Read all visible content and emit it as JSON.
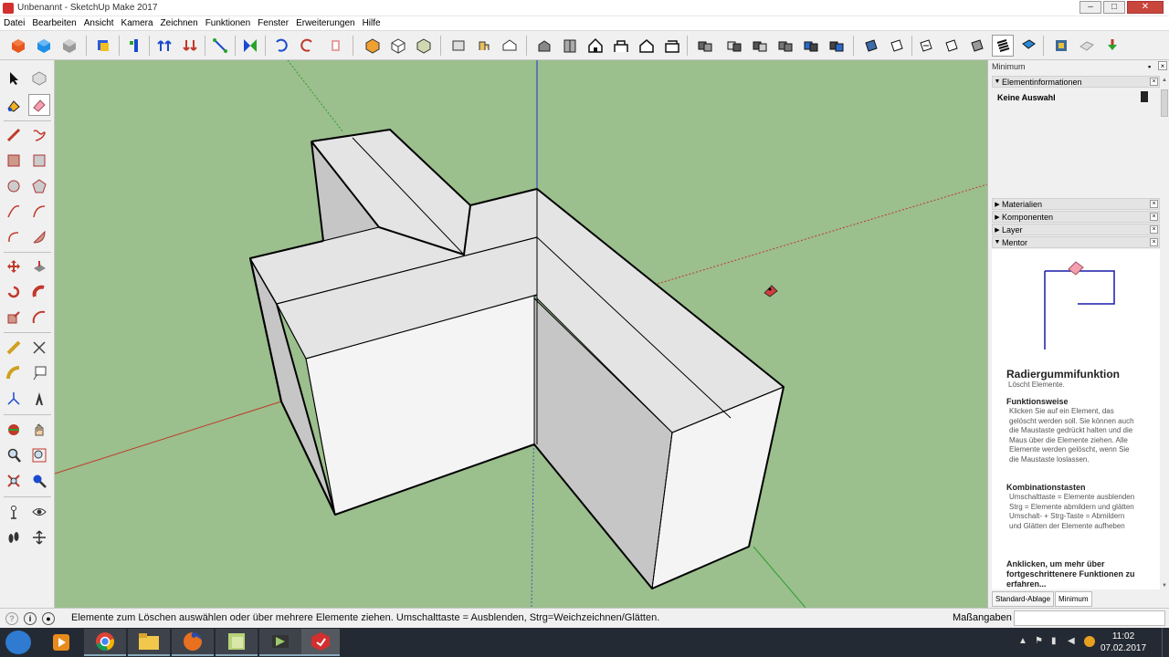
{
  "window": {
    "title": "Unbenannt - SketchUp Make 2017",
    "controls": [
      "–",
      "□",
      "✕"
    ]
  },
  "menu": [
    "Datei",
    "Bearbeiten",
    "Ansicht",
    "Kamera",
    "Zeichnen",
    "Funktionen",
    "Fenster",
    "Erweiterungen",
    "Hilfe"
  ],
  "tray": {
    "title": "Minimum",
    "panels": {
      "entity": {
        "header": "Elementinformationen",
        "value": "Keine Auswahl"
      },
      "materials": "Materialien",
      "components": "Komponenten",
      "layers": "Layer",
      "mentor": "Mentor"
    },
    "mentor": {
      "title": "Radiergummifunktion",
      "subtitle": "Löscht Elemente.",
      "how_heading": "Funktionsweise",
      "how_text": "Klicken Sie auf ein Element, das gelöscht werden soll. Sie können auch die Maustaste gedrückt halten und die Maus über die Elemente ziehen. Alle Elemente werden gelöscht, wenn Sie die Maustaste loslassen.",
      "keys_heading": "Kombinationstasten",
      "keys_text": "Umschalttaste = Elemente ausblenden\nStrg = Elemente abmildern und glätten\nUmschalt- + Strg-Taste = Abmildern und Glätten der Elemente aufheben",
      "more": "Anklicken, um mehr über fortgeschrittenere Funktionen zu erfahren..."
    },
    "tabs": [
      "Standard-Ablage",
      "Minimum"
    ]
  },
  "status": {
    "message": "Elemente zum Löschen auswählen oder über mehrere Elemente ziehen. Umschalttaste = Ausblenden, Strg=Weichzeichnen/Glätten.",
    "measure_label": "Maßangaben",
    "measure_value": ""
  },
  "clock": {
    "time": "11:02",
    "date": "07.02.2017"
  },
  "colors": {
    "viewport_bg": "#9bbf8d",
    "axis_red": "#c0392b",
    "axis_green": "#2e9e2e",
    "axis_blue": "#2233cc",
    "face_light": "#f4f4f4",
    "face_mid": "#e4e4e4",
    "face_dark": "#c6c6c6"
  },
  "icons": {
    "toolbar": [
      "get-models-icon",
      "3d-warehouse-icon",
      "share-component-icon",
      "styles-icon",
      "section-plane-icon",
      "push-pull-arrows-icon",
      "outer-shell-icon",
      "intersect-icon",
      "union-icon",
      "move-icon",
      "rotate-icon",
      "scale-icon",
      "paint-bucket-icon",
      "follow-me-icon",
      "offset-icon",
      "iso-view-icon",
      "top-view-icon",
      "front-view-icon",
      "right-view-icon",
      "back-view-icon",
      "left-view-icon",
      "xray-icon",
      "back-edges-icon",
      "wireframe-icon",
      "hidden-line-icon",
      "shaded-icon",
      "shaded-textures-icon",
      "monochrome-icon",
      "match-photo-icon",
      "solid-tools-icon",
      "sandbox-icon",
      "layers-icon",
      "shadows-icon",
      "extension-warehouse-icon",
      "photo-textures-icon",
      "add-location-icon"
    ],
    "left": [
      "select-arrow-icon",
      "make-component-icon",
      "paint-bucket-icon",
      "eraser-icon",
      "line-pencil-icon",
      "freehand-icon",
      "rectangle-icon",
      "rotated-rectangle-icon",
      "circle-icon",
      "polygon-icon",
      "arc-icon",
      "two-point-arc-icon",
      "three-point-arc-icon",
      "pie-icon",
      "move-icon",
      "push-pull-icon",
      "rotate-icon",
      "follow-me-icon",
      "scale-icon",
      "offset-icon",
      "tape-measure-icon",
      "dimension-icon",
      "protractor-icon",
      "text-icon",
      "axes-icon",
      "3d-text-icon",
      "orbit-icon",
      "pan-icon",
      "zoom-icon",
      "zoom-window-icon",
      "zoom-extents-icon",
      "position-camera-icon",
      "walk-icon",
      "look-around-icon",
      "footprints-icon",
      "section-plane-icon"
    ],
    "taskbar": [
      "windows-start-icon",
      "media-player-icon",
      "chrome-icon",
      "file-explorer-icon",
      "firefox-icon",
      "sticky-notes-icon",
      "video-editor-icon",
      "sketchup-icon"
    ]
  }
}
